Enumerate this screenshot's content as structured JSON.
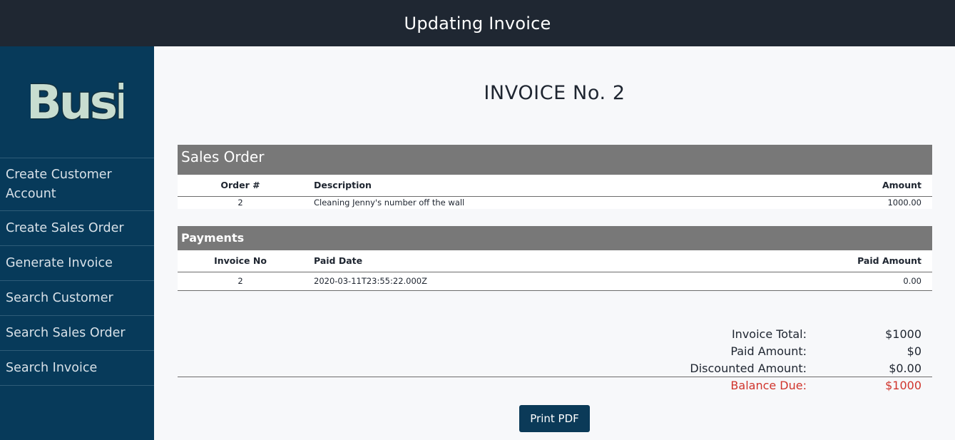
{
  "header": {
    "title": "Updating Invoice"
  },
  "sidebar": {
    "logo_text": "Busi",
    "items": [
      {
        "label": "Create Customer Account"
      },
      {
        "label": "Create Sales Order"
      },
      {
        "label": "Generate Invoice"
      },
      {
        "label": "Search Customer"
      },
      {
        "label": "Search Sales Order"
      },
      {
        "label": "Search Invoice"
      }
    ]
  },
  "invoice": {
    "title": "INVOICE No. 2"
  },
  "sales_order": {
    "heading": "Sales Order",
    "columns": [
      "Order #",
      "Description",
      "Amount"
    ],
    "rows": [
      {
        "order_no": "2",
        "description": "Cleaning Jenny's number off the wall",
        "amount": "1000.00"
      }
    ]
  },
  "payments": {
    "heading": "Payments",
    "columns": [
      "Invoice No",
      "Paid Date",
      "Paid Amount"
    ],
    "rows": [
      {
        "invoice_no": "2",
        "paid_date": "2020-03-11T23:55:22.000Z",
        "paid_amount": "0.00"
      }
    ]
  },
  "totals": {
    "invoice_total_label": "Invoice Total:",
    "invoice_total": "$1000",
    "paid_amount_label": "Paid Amount:",
    "paid_amount": "$0",
    "discounted_amount_label": "Discounted Amount:",
    "discounted_amount": "$0.00",
    "balance_due_label": "Balance Due:",
    "balance_due": "$1000"
  },
  "actions": {
    "print_label": "Print PDF"
  },
  "colors": {
    "header_bg": "#1f2732",
    "sidebar_bg": "#073a5a",
    "section_bg": "#787878",
    "balance_due": "#d0342c",
    "button_bg": "#0b3a58"
  }
}
